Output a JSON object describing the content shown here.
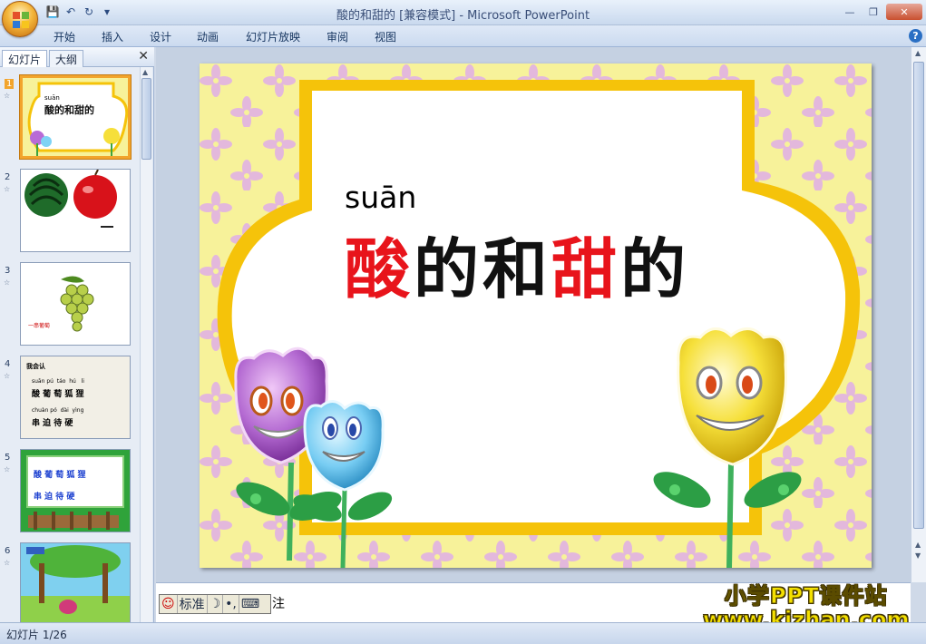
{
  "window": {
    "title": "酸的和甜的 [兼容模式] - Microsoft PowerPoint"
  },
  "ribbon": {
    "tabs": [
      "开始",
      "插入",
      "设计",
      "动画",
      "幻灯片放映",
      "审阅",
      "视图"
    ]
  },
  "left_panel": {
    "tab_slides": "幻灯片",
    "tab_outline": "大纲",
    "thumbnails": [
      {
        "num": "1",
        "caption_pinyin": "suān",
        "caption": "酸的和甜的"
      },
      {
        "num": "2"
      },
      {
        "num": "3",
        "caption": "一串葡萄"
      },
      {
        "num": "4",
        "caption": "我会认",
        "pinyin_row1": "suān pú  táo  hú   li",
        "chars_row1": "酸 葡 萄 狐 狸",
        "pinyin_row2": "chuàn pó  dài  yìng",
        "chars_row2": "串 迫 待 硬"
      },
      {
        "num": "5",
        "chars_row1": "酸 葡 萄 狐 狸",
        "chars_row2": "串 迫 待 硬"
      },
      {
        "num": "6"
      }
    ]
  },
  "slide": {
    "pinyin": "suān",
    "title_chars": [
      {
        "text": "酸",
        "color": "red"
      },
      {
        "text": "的",
        "color": "black"
      },
      {
        "text": "和",
        "color": "black"
      },
      {
        "text": "甜",
        "color": "red"
      },
      {
        "text": "的",
        "color": "black"
      }
    ]
  },
  "notes": {
    "ime_mode": "标准",
    "trailing_text": "注"
  },
  "status": {
    "slide_counter": "幻灯片 1/26"
  },
  "watermark": {
    "line1": "小学PPT课件站",
    "line2": "www.kjzhan.com"
  },
  "colors": {
    "accent_red": "#e8141b",
    "frame_yellow": "#f5c30a",
    "background_yellow": "#f7f29a"
  }
}
